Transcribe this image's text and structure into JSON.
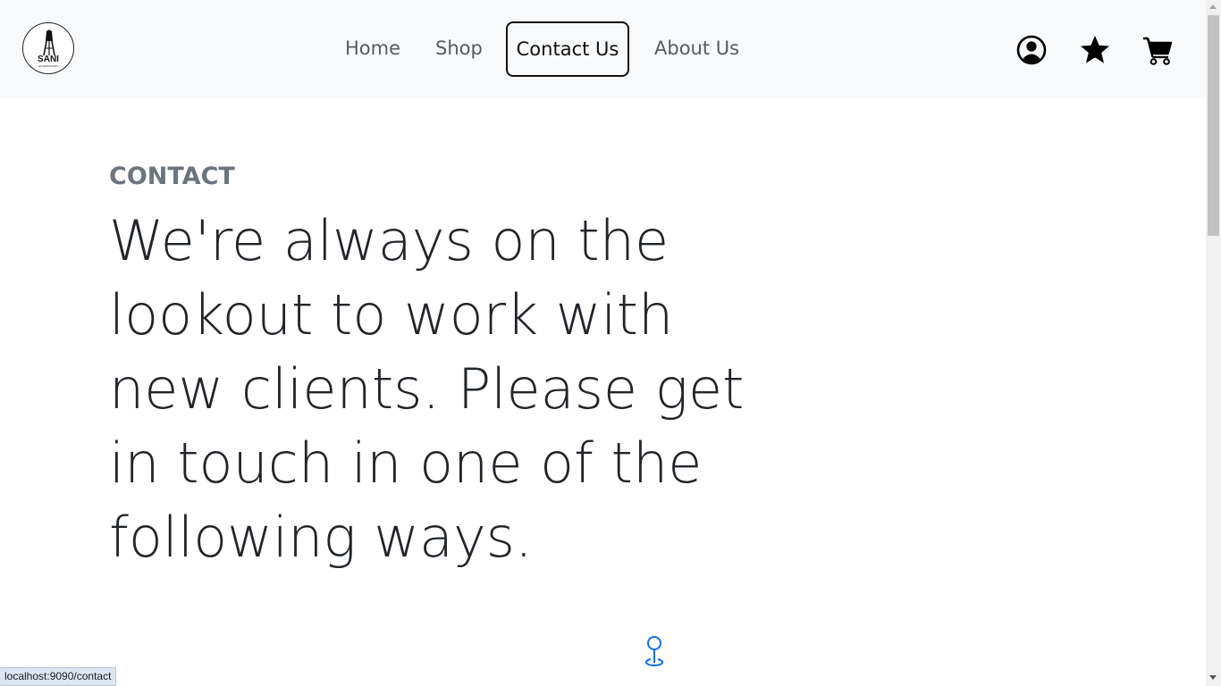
{
  "logo": {
    "name": "SANI",
    "tagline": "ENTERPRISES"
  },
  "nav": {
    "links": [
      {
        "label": "Home"
      },
      {
        "label": "Shop"
      },
      {
        "label": "Contact Us",
        "active": true
      },
      {
        "label": "About Us"
      }
    ],
    "icons": [
      "user-circle-icon",
      "star-icon",
      "shopping-cart-icon"
    ]
  },
  "main": {
    "section_label": "CONTACT",
    "headline": "We're always on the lookout to work with new clients. Please get in touch in one of the following ways.",
    "location_icon": "map-pin-icon"
  },
  "status_bar": {
    "url": "localhost:9090/contact"
  },
  "colors": {
    "navbar_bg": "#f8f9fa",
    "nav_text": "#555b60",
    "label_gray": "#6c757d",
    "headline_text": "#212529",
    "accent_blue": "#0d6efd"
  }
}
